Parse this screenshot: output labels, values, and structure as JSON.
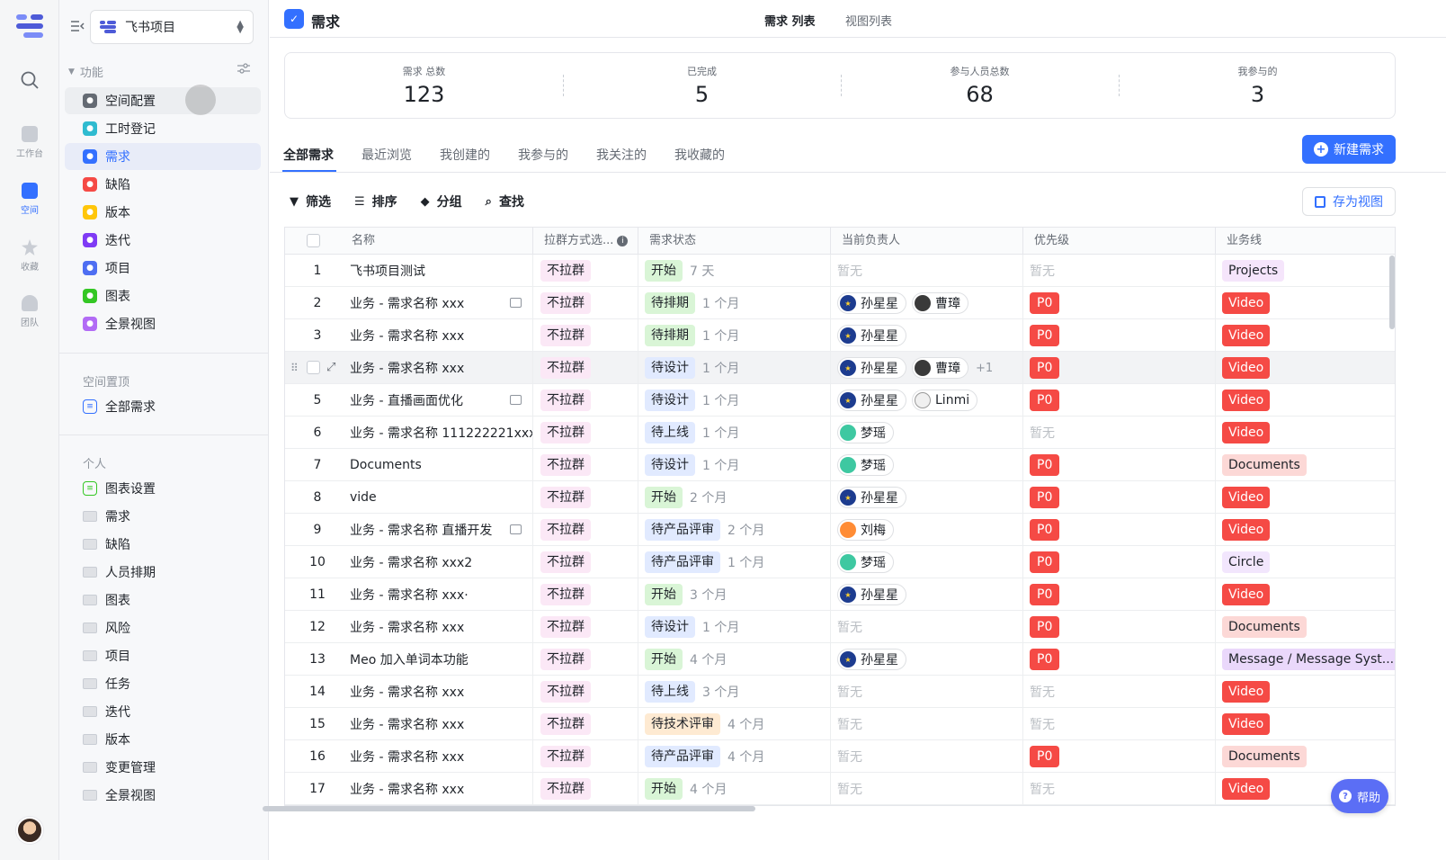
{
  "rail": {
    "items": [
      {
        "label": "工作台"
      },
      {
        "label": "空间"
      },
      {
        "label": "收藏"
      },
      {
        "label": "团队"
      }
    ]
  },
  "sidebar": {
    "project_name": "飞书项目",
    "section_features": "功能",
    "features": [
      {
        "label": "空间配置",
        "color": "#646a73",
        "icon": "gear-icon"
      },
      {
        "label": "工时登记",
        "color": "#2fbbd0",
        "icon": "clock-icon"
      },
      {
        "label": "需求",
        "color": "#3370ff",
        "icon": "check-icon"
      },
      {
        "label": "缺陷",
        "color": "#f54a45",
        "icon": "bug-icon"
      },
      {
        "label": "版本",
        "color": "#ffc60a",
        "icon": "bookmark-icon"
      },
      {
        "label": "迭代",
        "color": "#7f3bf5",
        "icon": "cycle-icon"
      },
      {
        "label": "项目",
        "color": "#4e6ef2",
        "icon": "folder-icon"
      },
      {
        "label": "图表",
        "color": "#34c724",
        "icon": "chart-icon"
      },
      {
        "label": "全景视图",
        "color": "#b26bf5",
        "icon": "panorama-icon"
      }
    ],
    "section_pinned": "空间置顶",
    "pinned": [
      {
        "label": "全部需求"
      }
    ],
    "section_personal": "个人",
    "personal": [
      {
        "label": "图表设置"
      },
      {
        "label": "需求"
      },
      {
        "label": "缺陷"
      },
      {
        "label": "人员排期"
      },
      {
        "label": "图表"
      },
      {
        "label": "风险"
      },
      {
        "label": "项目"
      },
      {
        "label": "任务"
      },
      {
        "label": "迭代"
      },
      {
        "label": "版本"
      },
      {
        "label": "变更管理"
      },
      {
        "label": "全景视图"
      }
    ]
  },
  "header": {
    "title": "需求",
    "view_tabs": [
      {
        "label": "需求 列表"
      },
      {
        "label": "视图列表"
      }
    ]
  },
  "stats": [
    {
      "label": "需求 总数",
      "value": "123"
    },
    {
      "label": "已完成",
      "value": "5"
    },
    {
      "label": "参与人员总数",
      "value": "68"
    },
    {
      "label": "我参与的",
      "value": "3"
    }
  ],
  "filter_tabs": [
    {
      "label": "全部需求"
    },
    {
      "label": "最近浏览"
    },
    {
      "label": "我创建的"
    },
    {
      "label": "我参与的"
    },
    {
      "label": "我关注的"
    },
    {
      "label": "我收藏的"
    }
  ],
  "new_button": "新建需求",
  "toolbar": {
    "filter": "筛选",
    "sort": "排序",
    "group": "分组",
    "find": "查找",
    "save_view": "存为视图"
  },
  "table": {
    "columns": [
      "名称",
      "拉群方式选...",
      "需求状态",
      "当前负责人",
      "优先级",
      "业务线"
    ],
    "rows": [
      {
        "n": "1",
        "name": "飞书项目测试",
        "group": "不拉群",
        "status": "开始",
        "st": "green",
        "dur": "7 天",
        "owners": [],
        "more": "",
        "prio": "",
        "line": "Projects",
        "lt": "proj",
        "cmt": false
      },
      {
        "n": "2",
        "name": "业务 - 需求名称 xxx",
        "group": "不拉群",
        "status": "待排期",
        "st": "green",
        "dur": "1 个月",
        "owners": [
          {
            "name": "孙星星",
            "av": "blue"
          },
          {
            "name": "曹璋",
            "av": "dark"
          }
        ],
        "more": "",
        "prio": "P0",
        "line": "Video",
        "lt": "video",
        "cmt": true
      },
      {
        "n": "3",
        "name": "业务 - 需求名称 xxx",
        "group": "不拉群",
        "status": "待排期",
        "st": "green",
        "dur": "1 个月",
        "owners": [
          {
            "name": "孙星星",
            "av": "blue"
          }
        ],
        "more": "",
        "prio": "P0",
        "line": "Video",
        "lt": "video",
        "cmt": false
      },
      {
        "n": "",
        "name": "业务 - 需求名称 xxx",
        "group": "不拉群",
        "status": "待设计",
        "st": "blue",
        "dur": "1 个月",
        "owners": [
          {
            "name": "孙星星",
            "av": "blue"
          },
          {
            "name": "曹璋",
            "av": "dark"
          }
        ],
        "more": "+1",
        "prio": "P0",
        "line": "Video",
        "lt": "video",
        "cmt": false
      },
      {
        "n": "5",
        "name": "业务 - 直播画面优化",
        "group": "不拉群",
        "status": "待设计",
        "st": "blue",
        "dur": "1 个月",
        "owners": [
          {
            "name": "孙星星",
            "av": "blue"
          },
          {
            "name": "Linmi",
            "av": "light"
          }
        ],
        "more": "",
        "prio": "P0",
        "line": "Video",
        "lt": "video",
        "cmt": true
      },
      {
        "n": "6",
        "name": "业务 - 需求名称 111222221xxx",
        "group": "不拉群",
        "status": "待上线",
        "st": "blue",
        "dur": "1 个月",
        "owners": [
          {
            "name": "梦瑶",
            "av": "teal"
          }
        ],
        "more": "",
        "prio": "",
        "line": "Video",
        "lt": "video",
        "cmt": false
      },
      {
        "n": "7",
        "name": "Documents",
        "group": "不拉群",
        "status": "待设计",
        "st": "blue",
        "dur": "1 个月",
        "owners": [
          {
            "name": "梦瑶",
            "av": "teal"
          }
        ],
        "more": "",
        "prio": "P0",
        "line": "Documents",
        "lt": "doc",
        "cmt": false
      },
      {
        "n": "8",
        "name": "vide",
        "group": "不拉群",
        "status": "开始",
        "st": "green",
        "dur": "2 个月",
        "owners": [
          {
            "name": "孙星星",
            "av": "blue"
          }
        ],
        "more": "",
        "prio": "P0",
        "line": "Video",
        "lt": "video",
        "cmt": false
      },
      {
        "n": "9",
        "name": "业务 - 需求名称 直播开发",
        "group": "不拉群",
        "status": "待产品评审",
        "st": "blue",
        "dur": "2 个月",
        "owners": [
          {
            "name": "刘梅",
            "av": "orange"
          }
        ],
        "more": "",
        "prio": "P0",
        "line": "Video",
        "lt": "video",
        "cmt": true
      },
      {
        "n": "10",
        "name": "业务 - 需求名称 xxx2",
        "group": "不拉群",
        "status": "待产品评审",
        "st": "blue",
        "dur": "1 个月",
        "owners": [
          {
            "name": "梦瑶",
            "av": "teal"
          }
        ],
        "more": "",
        "prio": "P0",
        "line": "Circle",
        "lt": "circle",
        "cmt": false
      },
      {
        "n": "11",
        "name": "业务 - 需求名称 xxx·",
        "group": "不拉群",
        "status": "开始",
        "st": "green",
        "dur": "3 个月",
        "owners": [
          {
            "name": "孙星星",
            "av": "blue"
          }
        ],
        "more": "",
        "prio": "P0",
        "line": "Video",
        "lt": "video",
        "cmt": false
      },
      {
        "n": "12",
        "name": "业务 - 需求名称 xxx",
        "group": "不拉群",
        "status": "待设计",
        "st": "blue",
        "dur": "1 个月",
        "owners": [],
        "more": "",
        "prio": "P0",
        "line": "Documents",
        "lt": "doc",
        "cmt": false
      },
      {
        "n": "13",
        "name": "Meo 加入单词本功能",
        "group": "不拉群",
        "status": "开始",
        "st": "green",
        "dur": "4 个月",
        "owners": [
          {
            "name": "孙星星",
            "av": "blue"
          }
        ],
        "more": "",
        "prio": "P0",
        "line": "Message / Message Syst...",
        "lt": "msg",
        "cmt": false
      },
      {
        "n": "14",
        "name": "业务 - 需求名称 xxx",
        "group": "不拉群",
        "status": "待上线",
        "st": "blue",
        "dur": "3 个月",
        "owners": [],
        "more": "",
        "prio": "",
        "line": "Video",
        "lt": "video",
        "cmt": false
      },
      {
        "n": "15",
        "name": "业务 - 需求名称 xxx",
        "group": "不拉群",
        "status": "待技术评审",
        "st": "orange",
        "dur": "4 个月",
        "owners": [],
        "more": "",
        "prio": "",
        "line": "Video",
        "lt": "video",
        "cmt": false
      },
      {
        "n": "16",
        "name": "业务 - 需求名称 xxx",
        "group": "不拉群",
        "status": "待产品评审",
        "st": "blue",
        "dur": "4 个月",
        "owners": [],
        "more": "",
        "prio": "P0",
        "line": "Documents",
        "lt": "doc",
        "cmt": false
      },
      {
        "n": "17",
        "name": "业务 - 需求名称 xxx",
        "group": "不拉群",
        "status": "开始",
        "st": "green",
        "dur": "4 个月",
        "owners": [],
        "more": "",
        "prio": "",
        "line": "Video",
        "lt": "video",
        "cmt": false
      }
    ],
    "empty_text": "暂无"
  },
  "help": "帮助"
}
